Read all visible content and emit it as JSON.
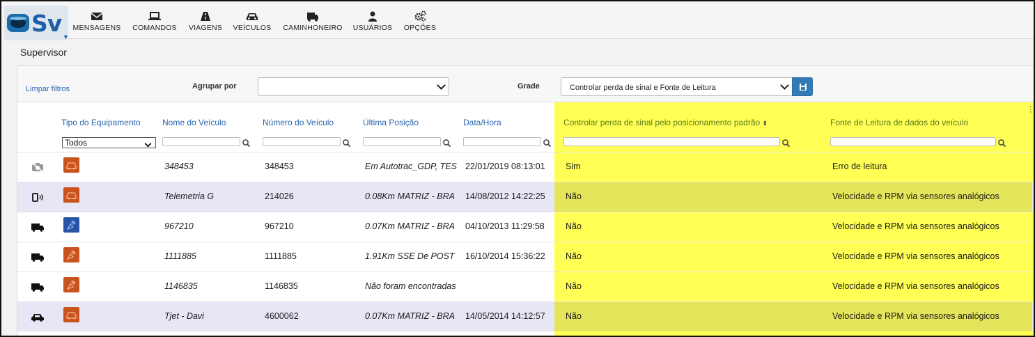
{
  "app": {
    "logo_text": "Sv"
  },
  "nav": [
    {
      "label": "MENSAGENS",
      "icon": "envelope-icon"
    },
    {
      "label": "COMANDOS",
      "icon": "laptop-icon"
    },
    {
      "label": "VIAGENS",
      "icon": "road-icon"
    },
    {
      "label": "VEÍCULOS",
      "icon": "car-icon"
    },
    {
      "label": "CAMINHONEIRO",
      "icon": "truck-icon"
    },
    {
      "label": "USUÁRIOS",
      "icon": "user-icon"
    },
    {
      "label": "OPÇÕES",
      "icon": "gears-icon"
    }
  ],
  "breadcrumb": "Supervisor",
  "filters": {
    "clear_label": "Limpar filtros",
    "group_label": "Agrupar por",
    "group_value": "",
    "grid_label": "Grade",
    "grid_value": "Controlar perda de sinal e Fonte de Leitura"
  },
  "columns": {
    "equipment": "Tipo do Equipamento",
    "equipment_filter": "Todos",
    "vehicle_name": "Nome do Veículo",
    "vehicle_number": "Número do Veículo",
    "last_position": "Última Posição",
    "datetime": "Data/Hora",
    "signal_loss": "Controlar perda de sinal pelo posicionamento padrão",
    "data_source": "Fonte de Leitura de dados do veículo"
  },
  "rows": [
    {
      "type_icon": "camera-off-icon",
      "equip": "orange",
      "name": "348453",
      "number": "348453",
      "position": "Em Autotrac_GDP, TES",
      "datetime": "22/01/2019 08:13:01",
      "signal": "Sim",
      "source": "Erro de leitura"
    },
    {
      "type_icon": "phone-signal-icon",
      "equip": "orange",
      "name": "Telemetria G",
      "number": "214026",
      "position": "0.08Km MATRIZ - BRA",
      "datetime": "14/08/2012 14:22:25",
      "signal": "Não",
      "source": "Velocidade e RPM via sensores analógicos"
    },
    {
      "type_icon": "truck-icon",
      "equip": "blue",
      "name": "967210",
      "number": "967210",
      "position": "0.07Km MATRIZ - BRA",
      "datetime": "04/10/2013 11:29:58",
      "signal": "Não",
      "source": "Velocidade e RPM via sensores analógicos"
    },
    {
      "type_icon": "truck-icon",
      "equip": "orange",
      "name": "1111885",
      "number": "1111885",
      "position": "1.91Km SSE De POST",
      "datetime": "16/10/2014 15:36:22",
      "signal": "Não",
      "source": "Velocidade e RPM via sensores analógicos"
    },
    {
      "type_icon": "truck-icon",
      "equip": "orange",
      "name": "1146835",
      "number": "1146835",
      "position": "Não foram encontradas",
      "datetime": "",
      "signal": "Não",
      "source": "Velocidade e RPM via sensores analógicos"
    },
    {
      "type_icon": "car-icon",
      "equip": "orange",
      "name": "Tjet - Davi",
      "number": "4600062",
      "position": "0.07Km MATRIZ - BRA",
      "datetime": "14/05/2014 14:12:57",
      "signal": "Não",
      "source": "Velocidade e RPM via sensores analógicos"
    }
  ]
}
